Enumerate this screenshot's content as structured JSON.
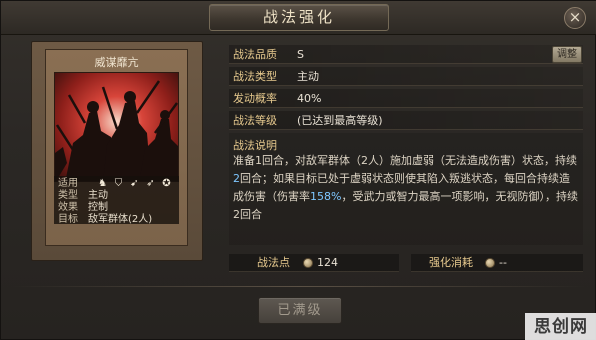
{
  "window": {
    "title": "战法强化",
    "close_glyph": "×"
  },
  "card": {
    "name": "威谋靡亢",
    "rows": [
      {
        "key": "适用",
        "value": ""
      },
      {
        "key": "类型",
        "value": "主动"
      },
      {
        "key": "效果",
        "value": "控制"
      },
      {
        "key": "目标",
        "value": "敌军群体(2人)"
      }
    ],
    "unit_icons": [
      "cavalry-icon",
      "shield-icon",
      "bow-icon",
      "spear-icon",
      "wheel-icon"
    ]
  },
  "attributes": {
    "quality": {
      "label": "战法品质",
      "value": "S"
    },
    "type": {
      "label": "战法类型",
      "value": "主动"
    },
    "trigger": {
      "label": "发动概率",
      "value": "40%"
    },
    "level": {
      "label": "战法等级",
      "value": "(已达到最高等级)"
    },
    "adjust_label": "调整"
  },
  "description": {
    "heading": "战法说明",
    "seg1": "准备1回合，对敌军群体（2人）施加虚弱（无法造成伤害）状态，持续",
    "seg2": "2",
    "seg3": "回合；如果目标已处于虚弱状态则使其陷入叛逃状态，每回合持续造成伤害（伤害率",
    "seg4": "158%",
    "seg5": "，受武力或智力最高一项影响，无视防御），持续2回合"
  },
  "stats": {
    "points_label": "战法点",
    "points_value": "124",
    "cost_label": "强化消耗",
    "cost_value": "--"
  },
  "maxed_button": "已满级",
  "watermark": "思创网"
}
